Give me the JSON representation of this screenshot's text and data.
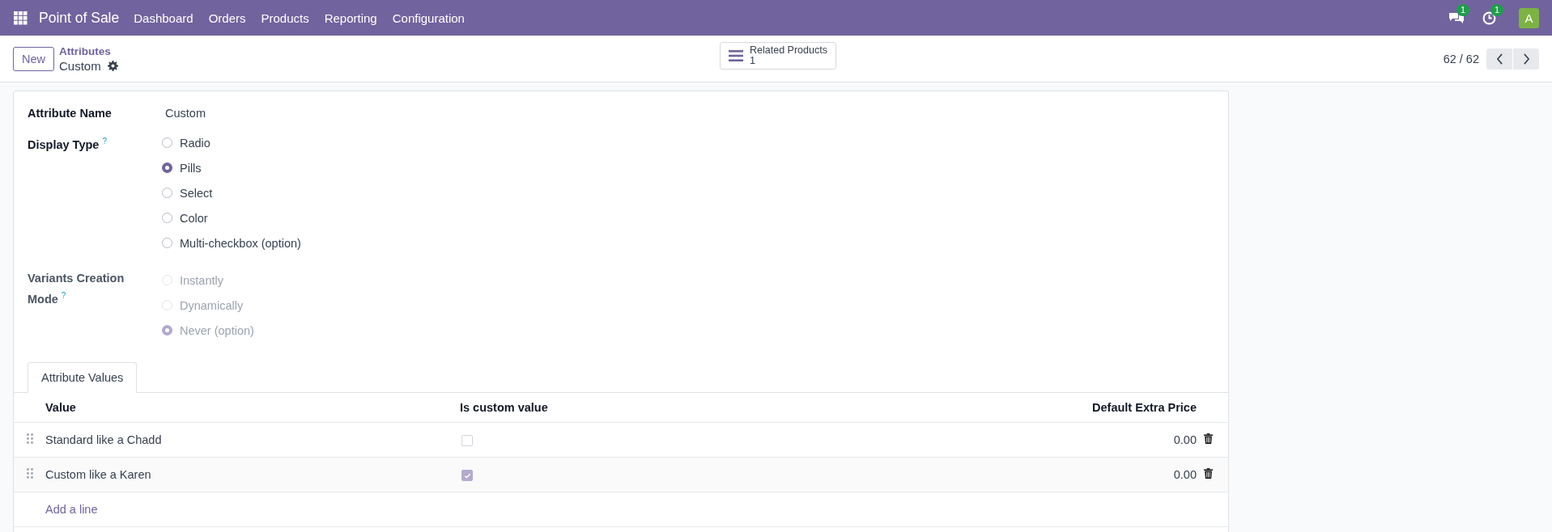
{
  "navbar": {
    "app_name": "Point of Sale",
    "menu": [
      "Dashboard",
      "Orders",
      "Products",
      "Reporting",
      "Configuration"
    ],
    "messages_badge": "1",
    "activities_badge": "1",
    "avatar": "A"
  },
  "control_panel": {
    "new_button": "New",
    "breadcrumb_parent": "Attributes",
    "record_title": "Custom",
    "smart_button": {
      "label": "Related Products",
      "count": "1"
    },
    "pager": "62 / 62"
  },
  "form": {
    "attribute_name": {
      "label": "Attribute Name",
      "value": "Custom"
    },
    "display_type": {
      "label": "Display Type",
      "help": "?",
      "options": [
        {
          "label": "Radio",
          "selected": false,
          "disabled": false
        },
        {
          "label": "Pills",
          "selected": true,
          "disabled": false
        },
        {
          "label": "Select",
          "selected": false,
          "disabled": false
        },
        {
          "label": "Color",
          "selected": false,
          "disabled": false
        },
        {
          "label": "Multi-checkbox (option)",
          "selected": false,
          "disabled": false
        }
      ]
    },
    "variants_creation_mode": {
      "label": "Variants Creation Mode",
      "help": "?",
      "options": [
        {
          "label": "Instantly",
          "selected": false,
          "disabled": true
        },
        {
          "label": "Dynamically",
          "selected": false,
          "disabled": true
        },
        {
          "label": "Never (option)",
          "selected": true,
          "disabled": true
        }
      ]
    }
  },
  "tabs": [
    {
      "label": "Attribute Values",
      "selected": true
    }
  ],
  "table": {
    "columns": [
      "Value",
      "Is custom value",
      "Default Extra Price"
    ],
    "rows": [
      {
        "value": "Standard like a Chadd",
        "is_custom_value": false,
        "default_extra_price": "0.00"
      },
      {
        "value": "Custom like a Karen",
        "is_custom_value": true,
        "default_extra_price": "0.00"
      }
    ],
    "add_line": "Add a line"
  }
}
